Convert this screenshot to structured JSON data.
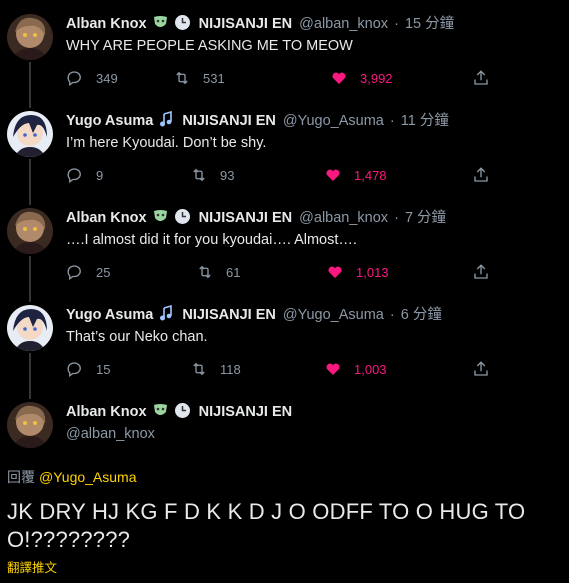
{
  "tweets": [
    {
      "name": "Alban Knox",
      "org": "NIJISANJI EN",
      "handle": "@alban_knox",
      "time": "15 分鐘",
      "text": "WHY ARE PEOPLE ASKING ME TO MEOW",
      "replies": "349",
      "retweets": "531",
      "likes": "3,992"
    },
    {
      "name": "Yugo Asuma",
      "org": "NIJISANJI EN",
      "handle": "@Yugo_Asuma",
      "time": "11 分鐘",
      "text": "I’m here Kyoudai. Don’t be shy.",
      "replies": "9",
      "retweets": "93",
      "likes": "1,478"
    },
    {
      "name": "Alban Knox",
      "org": "NIJISANJI EN",
      "handle": "@alban_knox",
      "time": "7 分鐘",
      "text": "….I almost did it for you kyoudai…. Almost….",
      "replies": "25",
      "retweets": "61",
      "likes": "1,013"
    },
    {
      "name": "Yugo Asuma",
      "org": "NIJISANJI EN",
      "handle": "@Yugo_Asuma",
      "time": "6 分鐘",
      "text": "That’s our Neko chan.",
      "replies": "15",
      "retweets": "118",
      "likes": "1,003"
    }
  ],
  "main_tweet": {
    "name": "Alban Knox",
    "org": "NIJISANJI EN",
    "handle": "@alban_knox",
    "reply_prefix": "回覆",
    "reply_to": "@Yugo_Asuma",
    "text": "JK DRY HJ  KG F D K  K D J O ODFF  TO O HUG TO O!????????",
    "translate_label": "翻譯推文"
  },
  "colors": {
    "background": "#000000",
    "text": "#e7e9ea",
    "muted": "#8b98a5",
    "like": "#f91880",
    "link": "#ffd400"
  }
}
